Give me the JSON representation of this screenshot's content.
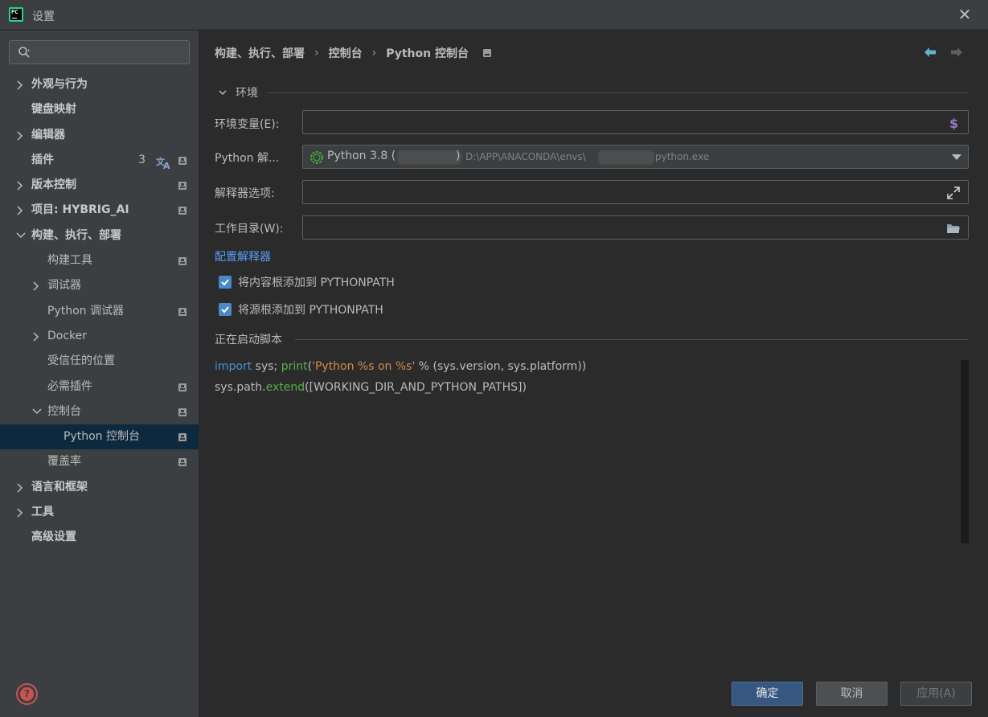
{
  "window": {
    "title": "设置",
    "app_icon_text": "PC"
  },
  "sidebar": {
    "search_placeholder": "",
    "items": [
      {
        "label": "外观与行为",
        "level": 0,
        "chevron": "right",
        "bold": true
      },
      {
        "label": "键盘映射",
        "level": 0,
        "chevron": "none",
        "bold": true
      },
      {
        "label": "编辑器",
        "level": 0,
        "chevron": "right",
        "bold": true
      },
      {
        "label": "插件",
        "level": 0,
        "chevron": "none",
        "bold": true,
        "count": "3",
        "translate_icon": true,
        "project_icon": true
      },
      {
        "label": "版本控制",
        "level": 0,
        "chevron": "right",
        "bold": true,
        "project_icon": true
      },
      {
        "label": "项目: HYBRIG_AI",
        "level": 0,
        "chevron": "right",
        "bold": true,
        "project_icon": true
      },
      {
        "label": "构建、执行、部署",
        "level": 0,
        "chevron": "down",
        "bold": true
      },
      {
        "label": "构建工具",
        "level": 1,
        "chevron": "none",
        "project_icon": true
      },
      {
        "label": "调试器",
        "level": 1,
        "chevron": "right"
      },
      {
        "label": "Python 调试器",
        "level": 1,
        "chevron": "none",
        "project_icon": true
      },
      {
        "label": "Docker",
        "level": 1,
        "chevron": "right"
      },
      {
        "label": "受信任的位置",
        "level": 1,
        "chevron": "none"
      },
      {
        "label": "必需插件",
        "level": 1,
        "chevron": "none",
        "project_icon": true
      },
      {
        "label": "控制台",
        "level": 1,
        "chevron": "down",
        "project_icon": true
      },
      {
        "label": "Python 控制台",
        "level": 2,
        "chevron": "none",
        "project_icon": true,
        "selected": true
      },
      {
        "label": "覆盖率",
        "level": 1,
        "chevron": "none",
        "project_icon": true
      },
      {
        "label": "语言和框架",
        "level": 0,
        "chevron": "right",
        "bold": true
      },
      {
        "label": "工具",
        "level": 0,
        "chevron": "right",
        "bold": true
      },
      {
        "label": "高级设置",
        "level": 0,
        "chevron": "none",
        "bold": true
      }
    ]
  },
  "breadcrumb": [
    "构建、执行、部署",
    "控制台",
    "Python 控制台"
  ],
  "sections": {
    "environment": "环境",
    "startup_script": "正在启动脚本"
  },
  "form": {
    "env_vars_label": "环境变量(E):",
    "env_vars_value": "",
    "interpreter_label": "Python 解...",
    "interpreter_name": "Python 3.8 (",
    "interpreter_close": ")",
    "interpreter_path": "D:\\APP\\ANACONDA\\envs\\",
    "interpreter_path_end": "python.exe",
    "interp_options_label": "解释器选项:",
    "interp_options_value": "",
    "working_dir_label": "工作目录(W):",
    "working_dir_value": "",
    "configure_link": "配置解释器",
    "checkbox_content_roots": "将内容根添加到 PYTHONPATH",
    "checkbox_source_roots": "将源根添加到 PYTHONPATH",
    "checkbox_content_roots_checked": true,
    "checkbox_source_roots_checked": true
  },
  "code": {
    "line1_kw": "import",
    "line1_a": " sys; ",
    "line1_fn": "print",
    "line1_b": "(",
    "line1_str": "'Python %s on %s'",
    "line1_c": " % (sys.version, sys.platform))",
    "line2_a": "sys.path.",
    "line2_fn": "extend",
    "line2_b": "([WORKING_DIR_AND_PYTHON_PATHS])"
  },
  "buttons": {
    "ok": "确定",
    "cancel": "取消",
    "apply": "应用(A)"
  },
  "icons": {
    "search": "search-icon",
    "close": "close-icon",
    "help": "help-icon",
    "back": "arrow-left-icon",
    "forward": "arrow-right-icon",
    "dollar": "dollar-icon",
    "expand": "expand-icon",
    "folder": "folder-icon",
    "translate": "translate-icon",
    "project": "project-icon"
  },
  "colors": {
    "accent": "#4a88c7",
    "link": "#589df6",
    "selection": "#0d293e",
    "keyword": "#4a8fd8",
    "function": "#58b04c",
    "string": "#d28b49",
    "help": "#c75450"
  }
}
